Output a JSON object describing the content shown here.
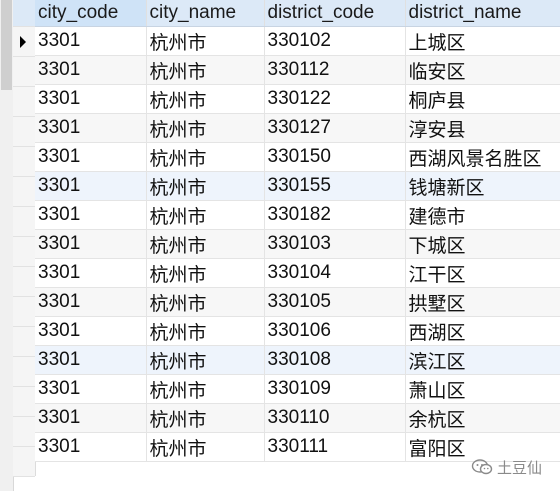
{
  "grid": {
    "columns": [
      "city_code",
      "city_name",
      "district_code",
      "district_name"
    ],
    "rows": [
      [
        "3301",
        "杭州市",
        "330102",
        "上城区"
      ],
      [
        "3301",
        "杭州市",
        "330112",
        "临安区"
      ],
      [
        "3301",
        "杭州市",
        "330122",
        "桐庐县"
      ],
      [
        "3301",
        "杭州市",
        "330127",
        "淳安县"
      ],
      [
        "3301",
        "杭州市",
        "330150",
        "西湖风景名胜区"
      ],
      [
        "3301",
        "杭州市",
        "330155",
        "钱塘新区"
      ],
      [
        "3301",
        "杭州市",
        "330182",
        "建德市"
      ],
      [
        "3301",
        "杭州市",
        "330103",
        "下城区"
      ],
      [
        "3301",
        "杭州市",
        "330104",
        "江干区"
      ],
      [
        "3301",
        "杭州市",
        "330105",
        "拱墅区"
      ],
      [
        "3301",
        "杭州市",
        "330106",
        "西湖区"
      ],
      [
        "3301",
        "杭州市",
        "330108",
        "滨江区"
      ],
      [
        "3301",
        "杭州市",
        "330109",
        "萧山区"
      ],
      [
        "3301",
        "杭州市",
        "330110",
        "余杭区"
      ],
      [
        "3301",
        "杭州市",
        "330111",
        "富阳区"
      ]
    ],
    "current_row_index": 0
  },
  "watermark": {
    "icon": "wechat-icon",
    "text": "土豆仙"
  },
  "colors": {
    "header_bg": "#dce9f7",
    "row_alt_bg": "#f7f7f7",
    "highlight_row_bg": "#eef4fc"
  }
}
